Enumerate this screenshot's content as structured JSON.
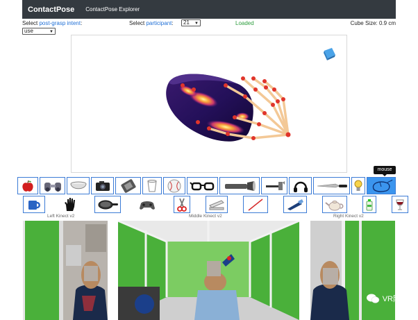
{
  "navbar": {
    "brand": "ContactPose",
    "link": "ContactPose Explorer"
  },
  "controls": {
    "intent_prefix": "Select ",
    "intent_link": "post-grasp intent",
    "intent_suffix": ":",
    "intent_value": "use",
    "participant_prefix": "Select ",
    "participant_link": "participant",
    "participant_suffix": ":",
    "participant_value": "21",
    "status": "Loaded",
    "cube_size": "Cube Size: 0.9 cm"
  },
  "objects_row1": [
    "apple",
    "binoculars",
    "bowl",
    "camera",
    "cell phone",
    "cup",
    "baseball",
    "eyeglasses",
    "flashlight",
    "hammer",
    "headphones",
    "knife",
    "light bulb",
    "mouse"
  ],
  "objects_row2": [
    "mug",
    "hand",
    "pan",
    "game controller",
    "scissors",
    "stapler",
    "stick",
    "toothbrush",
    "teapot",
    "toothpaste",
    "wine glass"
  ],
  "selected_object": "mouse",
  "tooltip": "mouse",
  "cameras": {
    "left": "Left Kinect v2",
    "middle": "Middle Kinect v2",
    "right": "Right Kinect v2"
  },
  "watermark": "VR陀螺",
  "colors": {
    "navbar": "#343a40",
    "link": "#1f6fd6",
    "loaded": "#2e9e3e",
    "selected": "#3b95ee",
    "border": "#3b7bd6"
  }
}
